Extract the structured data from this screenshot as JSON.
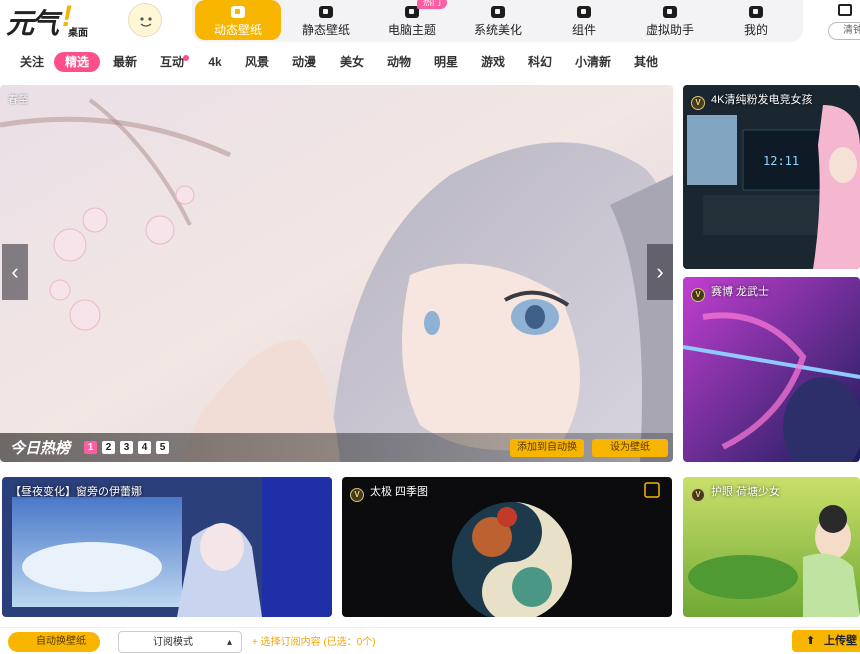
{
  "app": {
    "logo_text": "元气",
    "logo_sub": "桌面"
  },
  "nav": [
    {
      "label": "动态壁纸",
      "icon": "play-icon",
      "active": true
    },
    {
      "label": "静态壁纸",
      "icon": "image-icon"
    },
    {
      "label": "电脑主题",
      "icon": "shirt-icon",
      "badge": "热门"
    },
    {
      "label": "系统美化",
      "icon": "flower-icon"
    },
    {
      "label": "组件",
      "icon": "widget-icon"
    },
    {
      "label": "虚拟助手",
      "icon": "pet-icon"
    },
    {
      "label": "我的",
      "icon": "user-icon"
    }
  ],
  "right_pill": "清钟",
  "categories": [
    "关注",
    "精选",
    "最新",
    "互动",
    "4k",
    "风景",
    "动漫",
    "美女",
    "动物",
    "明星",
    "游戏",
    "科幻",
    "小清新",
    "其他"
  ],
  "selected_category": "精选",
  "hero": {
    "label": "春至",
    "hot_title": "今日热榜",
    "pages": [
      "1",
      "2",
      "3",
      "4",
      "5"
    ],
    "current_page": "1",
    "add_auto_label": "添加到自动换",
    "set_label": "设为壁纸"
  },
  "side_cards": [
    {
      "title": "4K清纯粉发电竞女孩"
    },
    {
      "title": "赛博 龙武士"
    }
  ],
  "grid_cards": [
    {
      "title": "【昼夜变化】窗旁の伊蕾娜",
      "vip": false
    },
    {
      "title": "太极 四季图",
      "vip": true
    },
    {
      "title": "护眼 荷塘少女",
      "vip": true
    }
  ],
  "bottom": {
    "auto_label": "自动换壁纸",
    "mode_label": "订阅模式",
    "subscribe_text": "+ 选择订阅内容 (已选：0个)",
    "upload_label": "上传壁"
  },
  "colors": {
    "accent": "#f7b500",
    "pink": "#ff4f8b"
  }
}
